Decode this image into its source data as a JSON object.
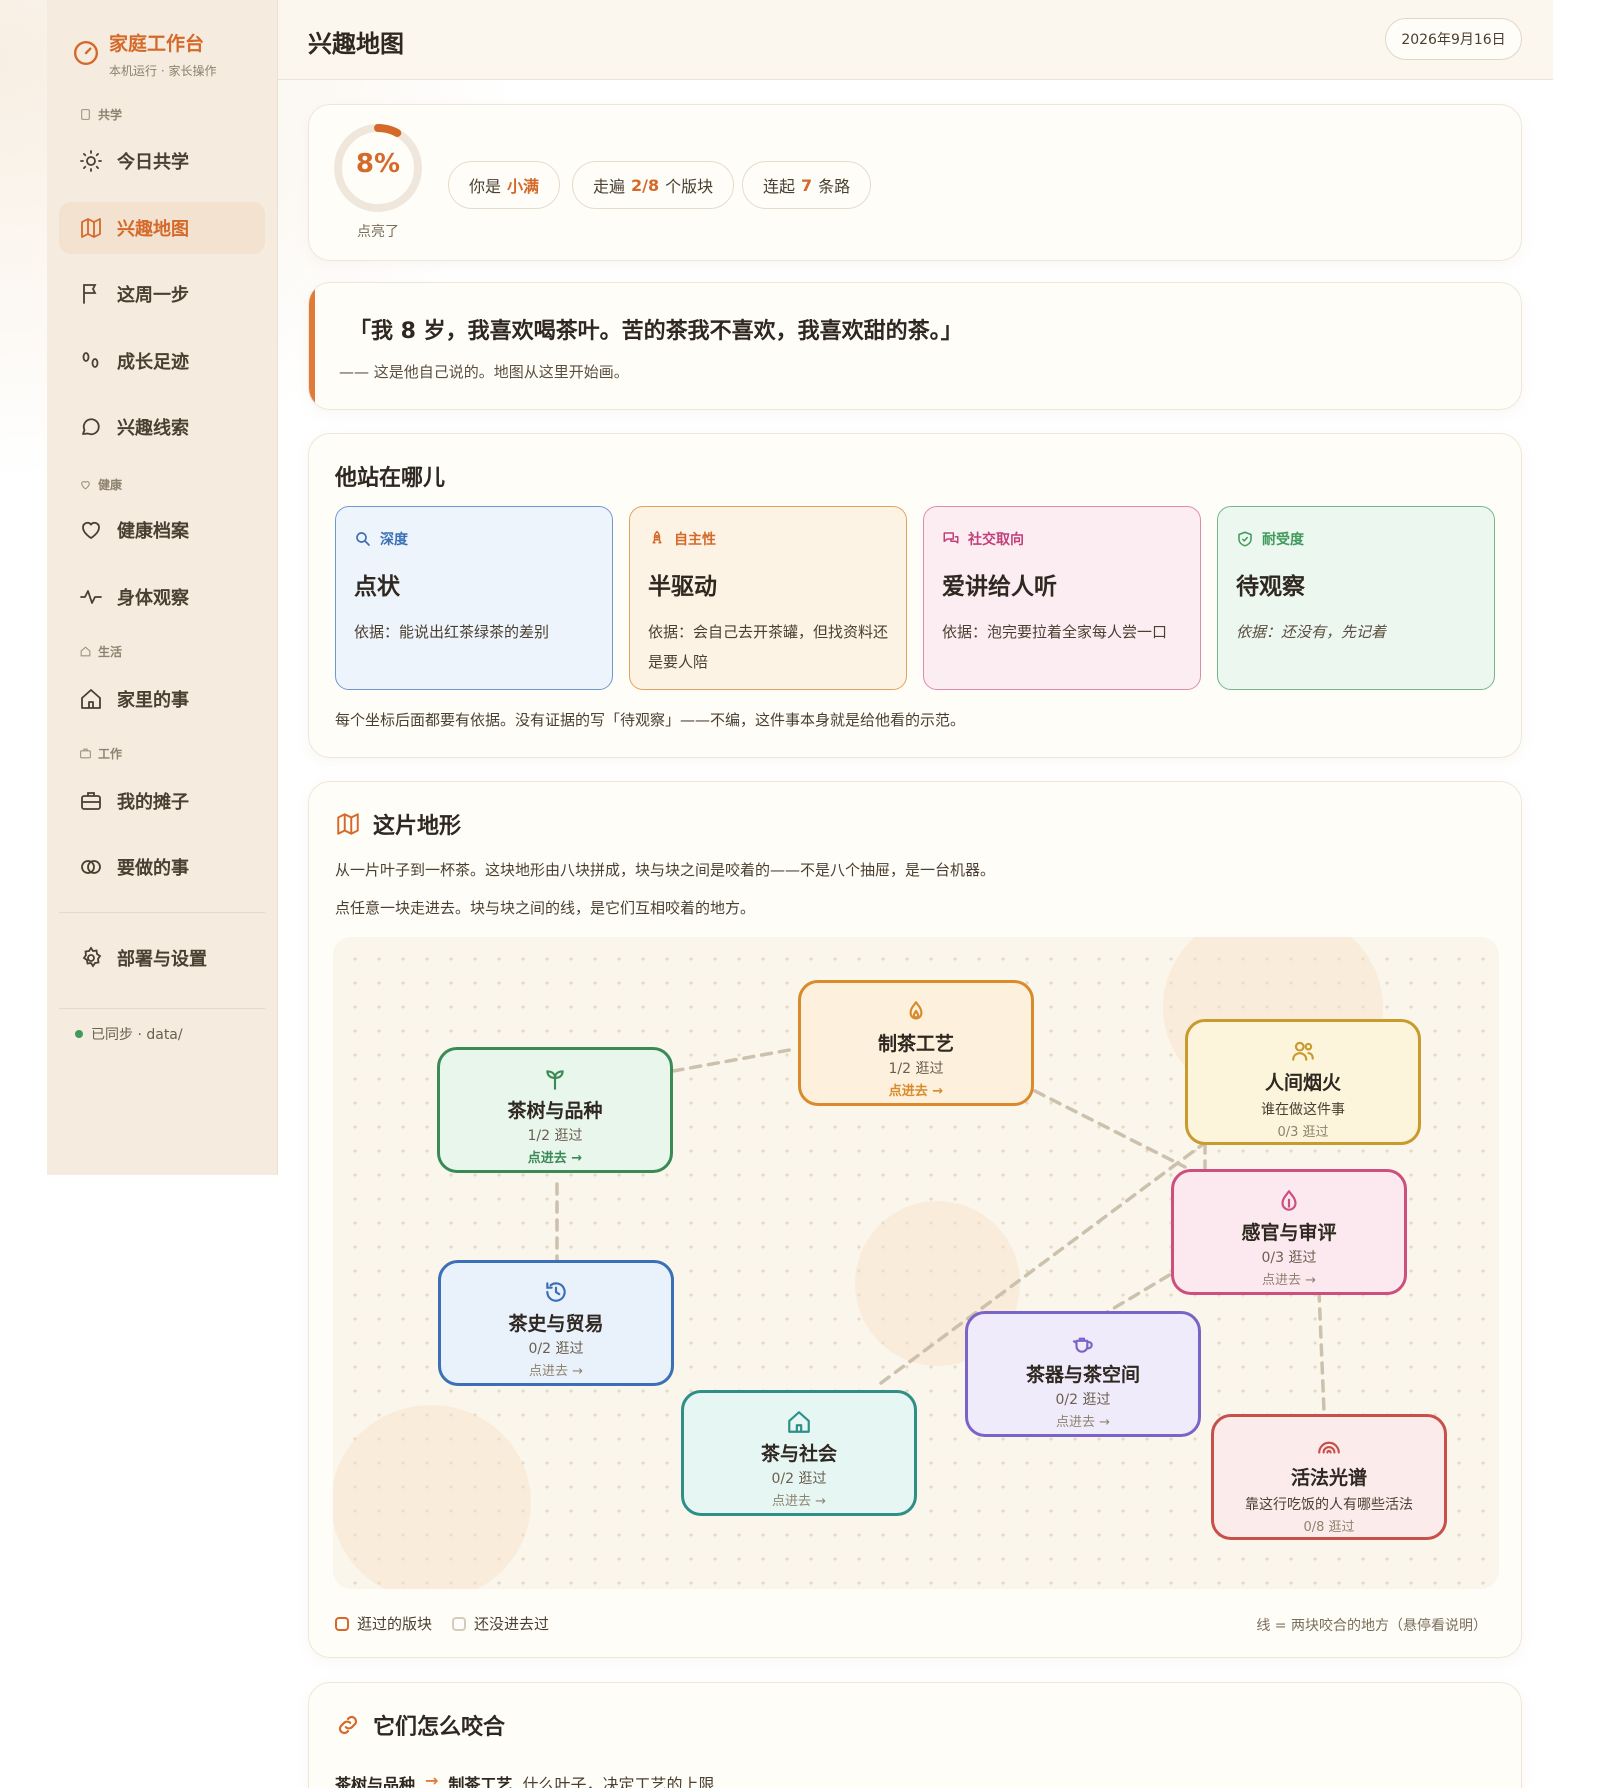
{
  "sidebar": {
    "brand_title": "家庭工作台",
    "brand_sub": "本机运行 · 家长操作",
    "sections": {
      "learn": "共学",
      "health": "健康",
      "life": "生活",
      "work": "工作"
    },
    "items": [
      {
        "label": "今日共学",
        "icon": "sun-icon"
      },
      {
        "label": "兴趣地图",
        "icon": "map-icon"
      },
      {
        "label": "这周一步",
        "icon": "flag-icon"
      },
      {
        "label": "成长足迹",
        "icon": "footprints-icon"
      },
      {
        "label": "兴趣线索",
        "icon": "chat-icon"
      },
      {
        "label": "健康档案",
        "icon": "heart-icon"
      },
      {
        "label": "身体观察",
        "icon": "pulse-icon"
      },
      {
        "label": "家里的事",
        "icon": "home-icon"
      },
      {
        "label": "我的摊子",
        "icon": "briefcase-icon"
      },
      {
        "label": "要做的事",
        "icon": "rings-icon"
      },
      {
        "label": "部署与设置",
        "icon": "gear-icon"
      }
    ],
    "active_item": "兴趣地图",
    "sync_text": "已同步 · data/"
  },
  "header": {
    "title": "兴趣地图",
    "date": "2026年9月16日"
  },
  "progress": {
    "percent": 8,
    "percent_text": "8%",
    "label": "点亮了",
    "pill_you_prefix": "你是",
    "pill_you_name": "小满",
    "pill_walk_prefix": "走遍",
    "pill_walk_value": "2/8",
    "pill_walk_suffix": "个版块",
    "pill_link_prefix": "连起",
    "pill_link_value": "7",
    "pill_link_suffix": "条路"
  },
  "quote": {
    "text": "「我 8 岁，我喜欢喝茶叶。苦的茶我不喜欢，我喜欢甜的茶。」",
    "sub": "—— 这是他自己说的。地图从这里开始画。"
  },
  "position": {
    "title": "他站在哪儿",
    "dimensions": [
      {
        "tag": "深度",
        "icon": "search-icon",
        "value": "点状",
        "basis": "依据：能说出红茶绿茶的差别",
        "color": "#3b6fb6"
      },
      {
        "tag": "自主性",
        "icon": "rocket-icon",
        "value": "半驱动",
        "basis": "依据：会自己去开茶罐，但找资料还是要人陪",
        "color": "#d4692a"
      },
      {
        "tag": "社交取向",
        "icon": "chat-bubbles-icon",
        "value": "爱讲给人听",
        "basis": "依据：泡完要拉着全家每人尝一口",
        "color": "#c2407a"
      },
      {
        "tag": "耐受度",
        "icon": "shield-icon",
        "value": "待观察",
        "basis": "依据：还没有，先记着",
        "color": "#3f9a5c"
      }
    ],
    "note": "每个坐标后面都要有依据。没有证据的写「待观察」——不编，这件事本身就是给他看的示范。"
  },
  "terrain": {
    "title": "这片地形",
    "desc1": "从一片叶子到一杯茶。这块地形由八块拼成，块与块之间是咬着的——不是八个抽屉，是一台机器。",
    "desc2": "点任意一块走进去。块与块之间的线，是它们互相咬着的地方。",
    "enter_label": "点进去 →",
    "nodes": [
      {
        "id": "craft",
        "title": "制茶工艺",
        "visited": "1/2 逛过",
        "icon": "flame-icon",
        "color": "#d98a2b",
        "bg": "#fdf0dc",
        "explored": true
      },
      {
        "id": "tree",
        "title": "茶树与品种",
        "visited": "1/2 逛过",
        "icon": "sprout-icon",
        "color": "#3a8a56",
        "bg": "#e9f6ec",
        "explored": true
      },
      {
        "id": "people",
        "title": "人间烟火",
        "subtitle": "谁在做这件事",
        "visited": "0/3 逛过",
        "icon": "people-icon",
        "color": "#c99a2e",
        "bg": "#fcf5dc",
        "explored": false
      },
      {
        "id": "sense",
        "title": "感官与审评",
        "visited": "0/3 逛过",
        "icon": "drop-icon",
        "color": "#cc4f7e",
        "bg": "#fce9f0",
        "explored": false
      },
      {
        "id": "history",
        "title": "茶史与贸易",
        "visited": "0/2 逛过",
        "icon": "history-icon",
        "color": "#3b6fb6",
        "bg": "#e9f1fb",
        "explored": false
      },
      {
        "id": "ware",
        "title": "茶器与茶空间",
        "visited": "0/2 逛过",
        "icon": "teapot-icon",
        "color": "#7a64c8",
        "bg": "#efebfb",
        "explored": false
      },
      {
        "id": "society",
        "title": "茶与社会",
        "visited": "0/2 逛过",
        "icon": "house-icon",
        "color": "#2f8f86",
        "bg": "#e6f6f3",
        "explored": false
      },
      {
        "id": "living",
        "title": "活法光谱",
        "subtitle": "靠这行吃饭的人有哪些活法",
        "visited": "0/8 逛过",
        "icon": "rainbow-icon",
        "color": "#c8504a",
        "bg": "#fbeceb",
        "explored": false
      }
    ],
    "legend_visited": "逛过的版块",
    "legend_unvisited": "还没进去过",
    "legend_note": "线 = 两块咬合的地方（悬停看说明）"
  },
  "bites": {
    "title": "它们怎么咬合",
    "first_from": "茶树与品种",
    "first_to": "制茶工艺",
    "first_desc": "什么叶子，决定工艺的上限"
  },
  "colors": {
    "accent": "#d4692a",
    "ok": "#3f9a5c"
  }
}
